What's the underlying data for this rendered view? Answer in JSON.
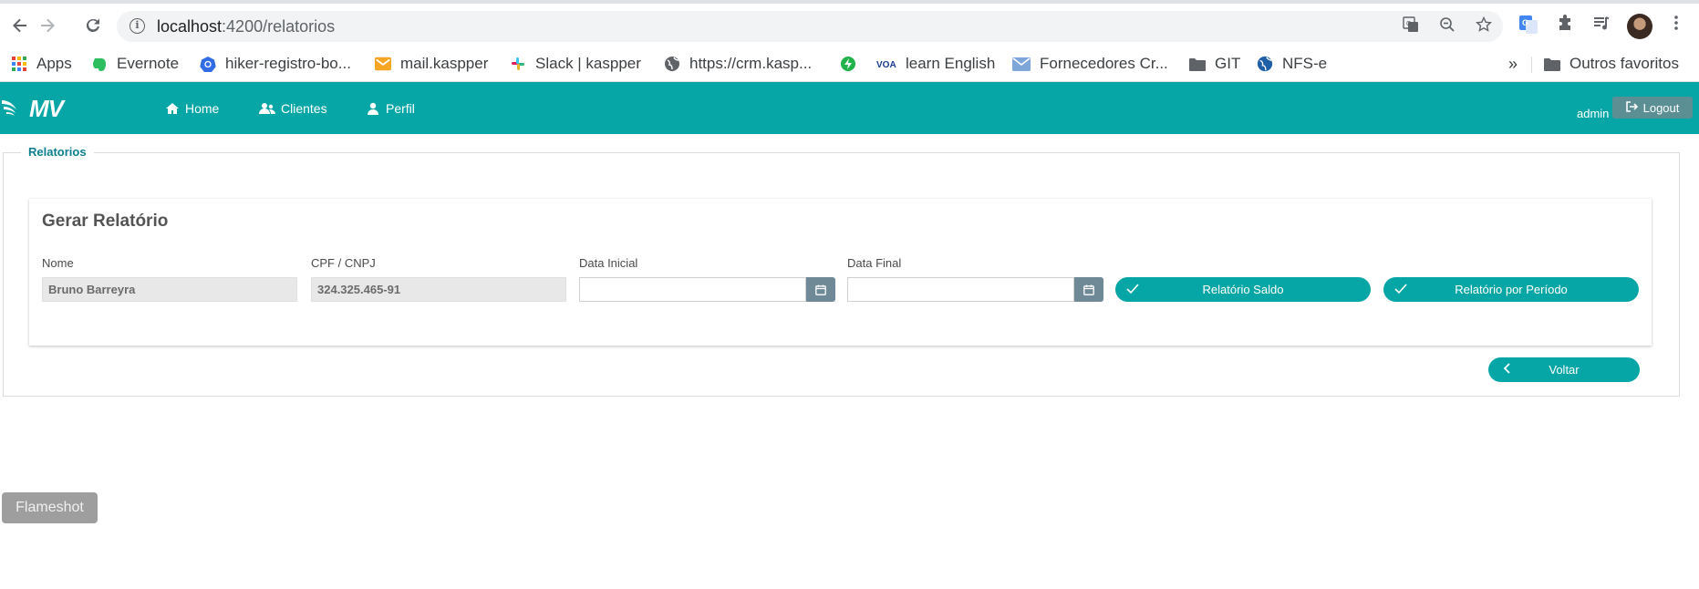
{
  "browser": {
    "url_host": "localhost",
    "url_path": ":4200/relatorios",
    "back_icon": "arrow-left-icon",
    "forward_icon": "arrow-right-icon",
    "reload_icon": "reload-icon",
    "bookmarks": [
      {
        "label": "Apps",
        "icon": "apps-grid-icon"
      },
      {
        "label": "Evernote",
        "icon": "evernote-icon"
      },
      {
        "label": "hiker-registro-bo...",
        "icon": "kubernetes-icon"
      },
      {
        "label": "mail.kaspper",
        "icon": "mail-icon"
      },
      {
        "label": "Slack | kaspper",
        "icon": "slack-icon"
      },
      {
        "label": "https://crm.kasp...",
        "icon": "globe-icon"
      },
      {
        "label": "",
        "icon": "bolt-icon"
      },
      {
        "label": "learn English",
        "icon": "voa-icon"
      },
      {
        "label": "Fornecedores Cr...",
        "icon": "envelope-icon"
      },
      {
        "label": "GIT",
        "icon": "folder-icon"
      },
      {
        "label": "NFS-e",
        "icon": "globe-blue-icon"
      }
    ],
    "more_bookmarks": "»",
    "other_bookmarks": "Outros favoritos"
  },
  "app": {
    "logo": "MV",
    "nav": [
      {
        "label": "Home",
        "icon": "home-icon"
      },
      {
        "label": "Clientes",
        "icon": "users-icon"
      },
      {
        "label": "Perfil",
        "icon": "user-icon"
      }
    ],
    "user": "admin",
    "logout": "Logout"
  },
  "page": {
    "legend": "Relatorios",
    "card_title": "Gerar Relatório",
    "fields": {
      "nome_label": "Nome",
      "nome_value": "Bruno Barreyra",
      "cpf_label": "CPF / CNPJ",
      "cpf_value": "324.325.465-91",
      "data_inicial_label": "Data Inicial",
      "data_inicial_value": "",
      "data_final_label": "Data Final",
      "data_final_value": ""
    },
    "buttons": {
      "saldo": "Relatório Saldo",
      "periodo": "Relatório por Período",
      "voltar": "Voltar"
    }
  },
  "overlay": {
    "flameshot": "Flameshot"
  },
  "colors": {
    "primary": "#07a6a6",
    "legend": "#0d7f8f",
    "calendar_button": "#6f8a96"
  }
}
